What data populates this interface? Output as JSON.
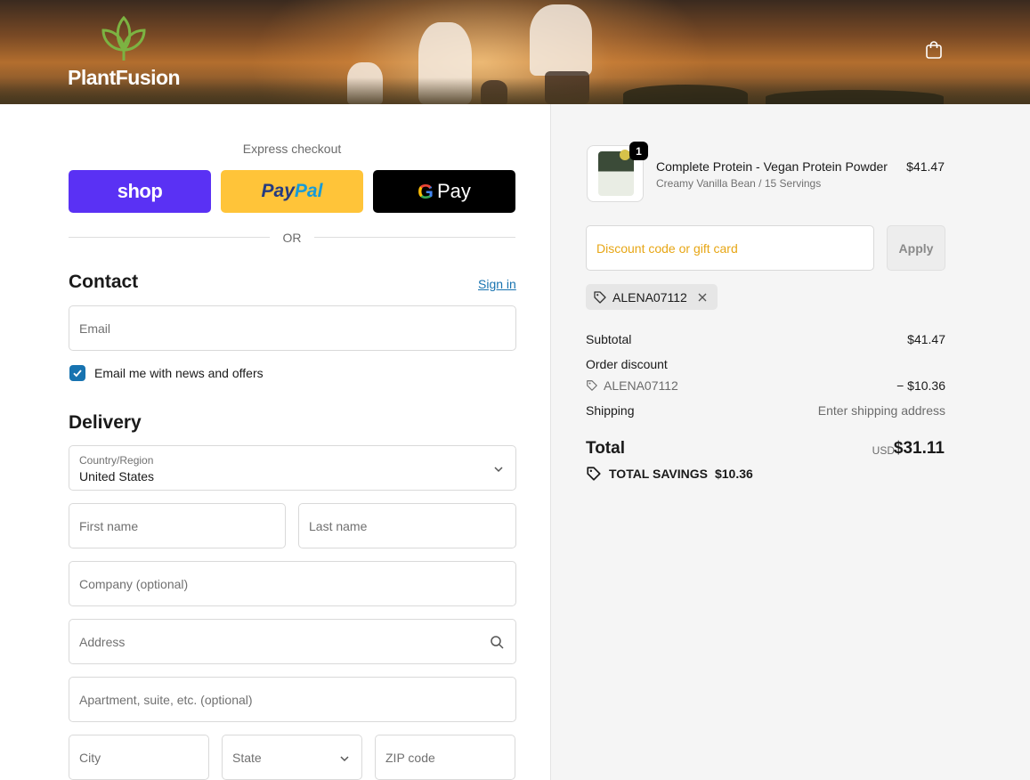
{
  "header": {
    "brand": "PlantFusion",
    "cart_icon": "shopping-bag-icon"
  },
  "express": {
    "title": "Express checkout",
    "shop_label": "shop",
    "paypal_label_1": "Pay",
    "paypal_label_2": "Pal",
    "gpay_g": "G",
    "gpay_label": "Pay",
    "or": "OR",
    "colors": {
      "shop": "#5a31f4",
      "paypal": "#ffc439",
      "gpay": "#000000"
    }
  },
  "contact": {
    "title": "Contact",
    "signin": "Sign in",
    "email_placeholder": "Email",
    "newsletter_label": "Email me with news and offers",
    "newsletter_checked": true
  },
  "delivery": {
    "title": "Delivery",
    "country_label": "Country/Region",
    "country_value": "United States",
    "first_name": "First name",
    "last_name": "Last name",
    "company": "Company (optional)",
    "address": "Address",
    "apartment": "Apartment, suite, etc. (optional)",
    "city": "City",
    "state": "State",
    "zip": "ZIP code"
  },
  "order": {
    "product": {
      "name": "Complete Protein - Vegan Protein Powder",
      "variant": "Creamy Vanilla Bean / 15 Servings",
      "price": "$41.47",
      "quantity": "1"
    },
    "discount_placeholder": "Discount code or gift card",
    "apply_label": "Apply",
    "applied_code": "ALENA07112",
    "subtotal_label": "Subtotal",
    "subtotal_value": "$41.47",
    "order_discount_label": "Order discount",
    "discount_code": "ALENA07112",
    "discount_value": "− $10.36",
    "shipping_label": "Shipping",
    "shipping_value": "Enter shipping address",
    "total_label": "Total",
    "currency": "USD",
    "total_value": "$31.11",
    "savings_label": "TOTAL SAVINGS",
    "savings_value": "$10.36",
    "accent_color": "#1773b0"
  }
}
